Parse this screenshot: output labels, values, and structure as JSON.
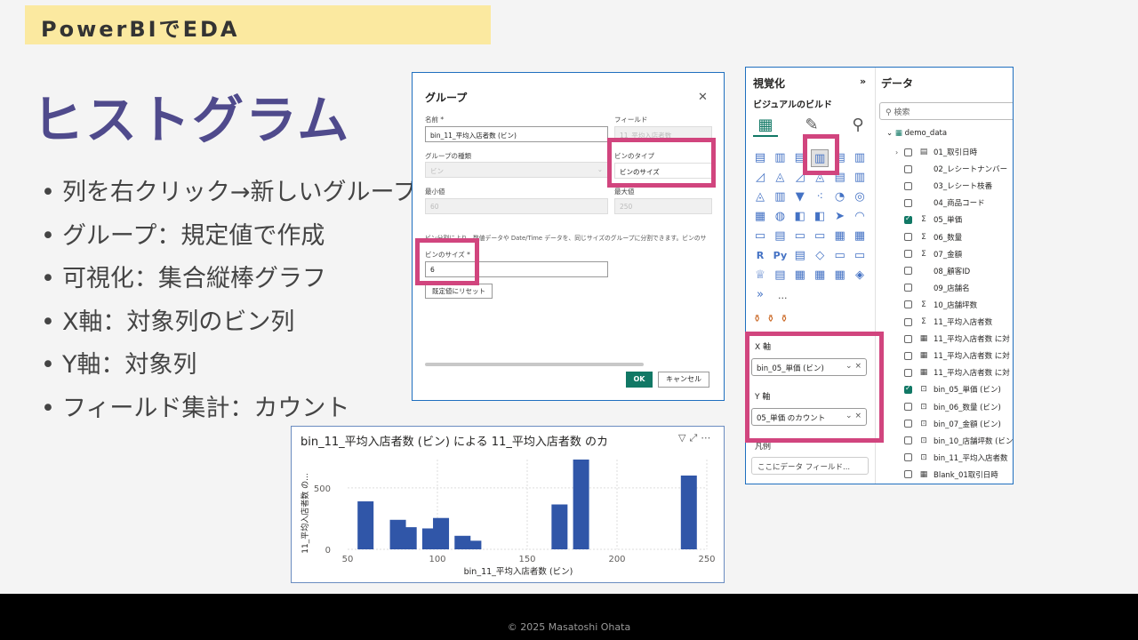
{
  "slide": {
    "header": "PowerBIでEDA",
    "title": "ヒストグラム",
    "bullets": [
      "列を右クリック→新しいグループ",
      "グループ：規定値で作成",
      "可視化：集合縦棒グラフ",
      "X軸：対象列のビン列",
      "Y軸：対象列",
      "フィールド集計：カウント"
    ],
    "footer": "© 2025 Masatoshi Ohata"
  },
  "dialog": {
    "title": "グループ",
    "close_icon": "close-icon",
    "name_label": "名前 *",
    "name_value": "bin_11_平均入店者数 (ビン)",
    "field_label": "フィールド",
    "field_value": "11_平均入店者数",
    "group_type_label": "グループの種類",
    "group_type_value": "ビン",
    "bin_type_label": "ビンのタイプ",
    "bin_type_value": "ビンのサイズ",
    "min_label": "最小値",
    "min_value": "60",
    "max_label": "最大値",
    "max_value": "250",
    "note": "ビン分割により、数値データや Date/Time データを、同じサイズのグループに分割できます。ビンのサ",
    "bin_size_label": "ビンのサイズ *",
    "bin_size_value": "6",
    "reset_label": "既定値にリセット",
    "ok_label": "OK",
    "cancel_label": "キャンセル"
  },
  "chart_data": {
    "type": "bar",
    "title": "bin_11_平均入店者数 (ビン) による 11_平均入店者数 のカ",
    "xlabel": "bin_11_平均入店者数 (ビン)",
    "ylabel": "11_平均入店者数 の...",
    "x": [
      60,
      78,
      84,
      96,
      102,
      114,
      120,
      168,
      180,
      240
    ],
    "values": [
      390,
      240,
      180,
      170,
      255,
      110,
      70,
      365,
      730,
      600
    ],
    "xlim": [
      50,
      250
    ],
    "ylim": [
      0,
      730
    ],
    "xticks": [
      50,
      100,
      150,
      200,
      250
    ],
    "yticks": [
      0,
      500
    ],
    "bar_color": "#3056a8",
    "grid": true
  },
  "viz_pane": {
    "title": "視覚化",
    "collapse_icon": "chevron-right-icon",
    "build_label": "ビジュアルのビルド",
    "more_label": "...",
    "x_axis_label": "X 軸",
    "x_axis_field": "bin_05_単価 (ビン)",
    "y_axis_label": "Y 軸",
    "y_axis_field": "05_単価 のカウント",
    "legend_label": "凡例",
    "legend_placeholder": "ここにデータ フィールド..."
  },
  "data_pane": {
    "title": "データ",
    "search_placeholder": "検索",
    "table": "demo_data",
    "fields": [
      {
        "name": "01_取引日時",
        "type": "date",
        "checked": false,
        "expand": true
      },
      {
        "name": "02_レシートナンバー",
        "type": "",
        "checked": false
      },
      {
        "name": "03_レシート枝番",
        "type": "",
        "checked": false
      },
      {
        "name": "04_商品コード",
        "type": "",
        "checked": false
      },
      {
        "name": "05_単価",
        "type": "sum",
        "checked": true
      },
      {
        "name": "06_数量",
        "type": "sum",
        "checked": false
      },
      {
        "name": "07_金額",
        "type": "sum",
        "checked": false
      },
      {
        "name": "08_顧客ID",
        "type": "",
        "checked": false
      },
      {
        "name": "09_店舗名",
        "type": "",
        "checked": false
      },
      {
        "name": "10_店舗坪数",
        "type": "sum",
        "checked": false
      },
      {
        "name": "11_平均入店者数",
        "type": "sum",
        "checked": false
      },
      {
        "name": "11_平均入店者数 に対",
        "type": "calc",
        "checked": false
      },
      {
        "name": "11_平均入店者数 に対",
        "type": "calc",
        "checked": false
      },
      {
        "name": "11_平均入店者数 に対",
        "type": "calc",
        "checked": false
      },
      {
        "name": "bin_05_単価 (ビン)",
        "type": "bin",
        "checked": true
      },
      {
        "name": "bin_06_数量 (ビン)",
        "type": "bin",
        "checked": false
      },
      {
        "name": "bin_07_金額 (ビン)",
        "type": "bin",
        "checked": false
      },
      {
        "name": "bin_10_店舗坪数 (ビン",
        "type": "bin",
        "checked": false
      },
      {
        "name": "bin_11_平均入店者数",
        "type": "bin",
        "checked": false
      },
      {
        "name": "Blank_01取引日時",
        "type": "calc",
        "checked": false
      }
    ]
  }
}
